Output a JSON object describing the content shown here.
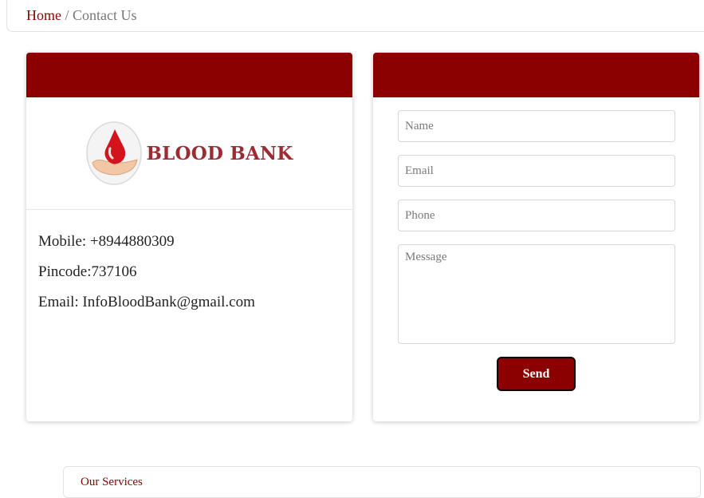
{
  "breadcrumb": {
    "home": "Home",
    "separator": " / ",
    "current": "Contact Us"
  },
  "logo": {
    "text": "BLOOD BANK",
    "icon": "blood-drop-hand-icon"
  },
  "contact": {
    "mobile": "Mobile: +8944880309",
    "pincode": "Pincode:737106",
    "email": "Email: InfoBloodBank@gmail.com"
  },
  "form": {
    "name_placeholder": "Name",
    "email_placeholder": "Email",
    "phone_placeholder": "Phone",
    "message_placeholder": "Message",
    "send_label": "Send"
  },
  "services": {
    "title": "Our Services"
  },
  "colors": {
    "brand": "#8b0000",
    "logo_text": "#9b2c34"
  }
}
